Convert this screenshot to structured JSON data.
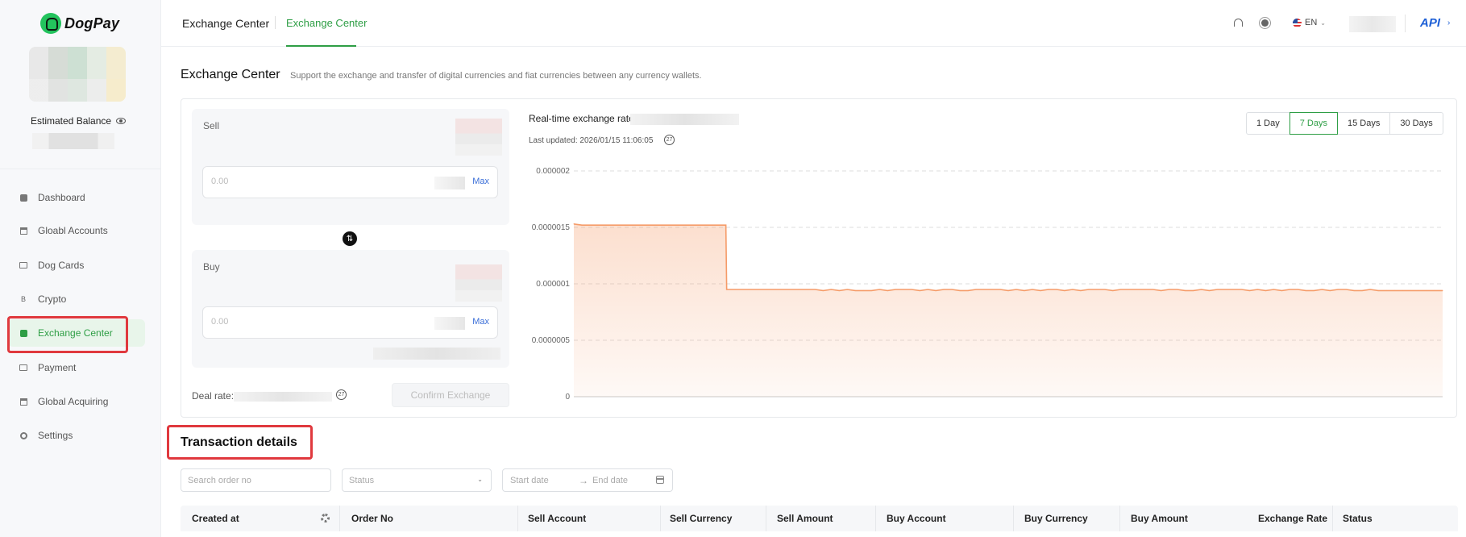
{
  "app": {
    "logo_text": "DogPay"
  },
  "sidebar": {
    "estimated_balance_label": "Estimated Balance",
    "items": [
      {
        "label": "Dashboard",
        "icon": "dashboard-icon"
      },
      {
        "label": "Gloabl Accounts",
        "icon": "bank-icon"
      },
      {
        "label": "Dog Cards",
        "icon": "card-icon"
      },
      {
        "label": "Crypto",
        "icon": "bitcoin-icon",
        "glyph": "B"
      },
      {
        "label": "Exchange Center",
        "icon": "exchange-icon",
        "active": true
      },
      {
        "label": "Payment",
        "icon": "payment-icon"
      },
      {
        "label": "Global Acquiring",
        "icon": "acquiring-icon"
      },
      {
        "label": "Settings",
        "icon": "settings-icon"
      }
    ]
  },
  "topbar": {
    "breadcrumb_root": "Exchange Center",
    "breadcrumb_current": "Exchange Center",
    "language": "EN",
    "api_label": "API",
    "chevron": "›"
  },
  "page": {
    "title": "Exchange Center",
    "subtitle": "Support the exchange and transfer of digital currencies and fiat currencies between any currency wallets."
  },
  "exchange": {
    "sell_label": "Sell",
    "buy_label": "Buy",
    "amount_placeholder": "0.00",
    "max_label": "Max",
    "deal_rate_label": "Deal rate:",
    "confirm_label": "Confirm Exchange",
    "timer_glyph": "27",
    "swap_glyph": "⇅"
  },
  "rate_panel": {
    "label": "Real-time exchange rate",
    "last_updated": "Last updated: 2026/01/15 11:06:05",
    "ranges": [
      {
        "label": "1 Day",
        "active": false
      },
      {
        "label": "7 Days",
        "active": true
      },
      {
        "label": "15 Days",
        "active": false
      },
      {
        "label": "30 Days",
        "active": false
      }
    ]
  },
  "chart_data": {
    "type": "area",
    "title": "",
    "xlabel": "",
    "ylabel": "",
    "ylim": [
      0,
      2e-06
    ],
    "yticks": [
      "0",
      "0.0000005",
      "0.000001",
      "0.0000015",
      "0.000002"
    ],
    "grid": true,
    "color": "#f59b68",
    "series": [
      {
        "values": [
          1.53e-06,
          1.52e-06,
          1.52e-06,
          1.52e-06,
          1.52e-06,
          1.52e-06,
          1.52e-06,
          1.52e-06,
          1.52e-06,
          1.52e-06,
          1.52e-06,
          1.52e-06,
          1.52e-06,
          1.52e-06,
          1.52e-06,
          1.52e-06,
          1.52e-06,
          1.52e-06,
          1.52e-06,
          9.5e-07,
          9.5e-07,
          9.5e-07,
          9.5e-07,
          9.5e-07,
          9.5e-07,
          9.5e-07,
          9.5e-07,
          9.5e-07,
          9.5e-07,
          9.5e-07,
          9.5e-07,
          9.4e-07,
          9.5e-07,
          9.4e-07,
          9.5e-07,
          9.4e-07,
          9.4e-07,
          9.4e-07,
          9.5e-07,
          9.4e-07,
          9.5e-07,
          9.5e-07,
          9.5e-07,
          9.4e-07,
          9.5e-07,
          9.4e-07,
          9.5e-07,
          9.5e-07,
          9.4e-07,
          9.4e-07,
          9.5e-07,
          9.5e-07,
          9.5e-07,
          9.5e-07,
          9.4e-07,
          9.5e-07,
          9.4e-07,
          9.5e-07,
          9.4e-07,
          9.5e-07,
          9.5e-07,
          9.4e-07,
          9.5e-07,
          9.4e-07,
          9.5e-07,
          9.5e-07,
          9.5e-07,
          9.4e-07,
          9.5e-07,
          9.5e-07,
          9.5e-07,
          9.5e-07,
          9.5e-07,
          9.4e-07,
          9.5e-07,
          9.5e-07,
          9.4e-07,
          9.4e-07,
          9.5e-07,
          9.4e-07,
          9.5e-07,
          9.5e-07,
          9.5e-07,
          9.5e-07,
          9.4e-07,
          9.5e-07,
          9.4e-07,
          9.5e-07,
          9.4e-07,
          9.5e-07,
          9.5e-07,
          9.4e-07,
          9.4e-07,
          9.5e-07,
          9.4e-07,
          9.5e-07,
          9.5e-07,
          9.4e-07,
          9.4e-07,
          9.5e-07,
          9.4e-07,
          9.4e-07,
          9.4e-07,
          9.4e-07,
          9.4e-07,
          9.4e-07,
          9.4e-07,
          9.4e-07,
          9.4e-07
        ]
      }
    ]
  },
  "transactions": {
    "title": "Transaction details",
    "search_placeholder": "Search order no",
    "status_placeholder": "Status",
    "start_date_placeholder": "Start date",
    "end_date_placeholder": "End date",
    "arrow": "→",
    "columns": [
      "Created at",
      "Order No",
      "Sell Account",
      "Sell Currency",
      "Sell Amount",
      "Buy Account",
      "Buy Currency",
      "Buy Amount",
      "Exchange Rate",
      "Status"
    ]
  }
}
